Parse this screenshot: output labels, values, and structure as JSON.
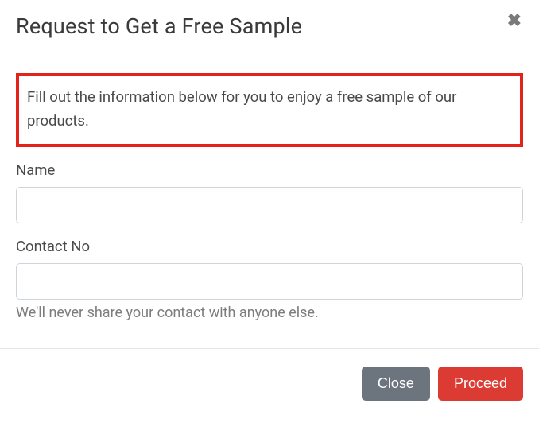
{
  "modal": {
    "title": "Request to Get a Free Sample",
    "close_glyph": "✖",
    "intro": "Fill out the information below for you to enjoy a free sample of our products.",
    "name_label": "Name",
    "name_value": "",
    "contact_label": "Contact No",
    "contact_value": "",
    "contact_help": "We'll never share your contact with anyone else.",
    "close_label": "Close",
    "proceed_label": "Proceed"
  }
}
